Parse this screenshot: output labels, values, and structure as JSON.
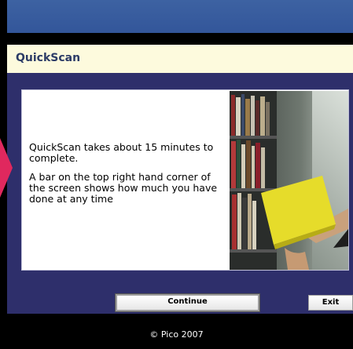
{
  "header": {
    "title": "QuickScan"
  },
  "content": {
    "paragraph_1": "QuickScan takes about 15 minutes to complete.",
    "paragraph_2": "A bar on the top right hand corner of the screen shows how much you have done at any time"
  },
  "buttons": {
    "continue_label": "Continue",
    "exit_label": "Exit"
  },
  "footer": {
    "copyright": "© Pico 2007"
  },
  "colors": {
    "top_bar": "#3d62a2",
    "title_bar": "#fdfadd",
    "main_background": "#2e2f6b",
    "arrow_accent": "#e0285e",
    "book": "#e6dc2a"
  },
  "icons": {
    "pointer": "pink-arrow-icon"
  }
}
